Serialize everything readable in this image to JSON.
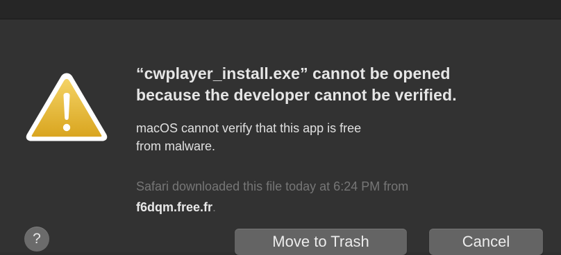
{
  "dialog": {
    "title_lines": [
      "“cwplayer_install.exe” cannot be opened",
      "because the developer cannot be verified."
    ],
    "message_lines": [
      "macOS cannot verify that this app is free",
      "from malware."
    ],
    "source_line_1": "Safari downloaded this file today at 6:24 PM from",
    "source_domain": "f6dqm.free.fr",
    "source_period": ".",
    "help_label": "?",
    "buttons": {
      "trash_label": "Move to Trash",
      "cancel_label": "Cancel"
    },
    "icon": "warning-triangle-icon",
    "colors": {
      "background": "#323232",
      "button": "#646464",
      "warning_yellow": "#e8bc3a"
    }
  }
}
